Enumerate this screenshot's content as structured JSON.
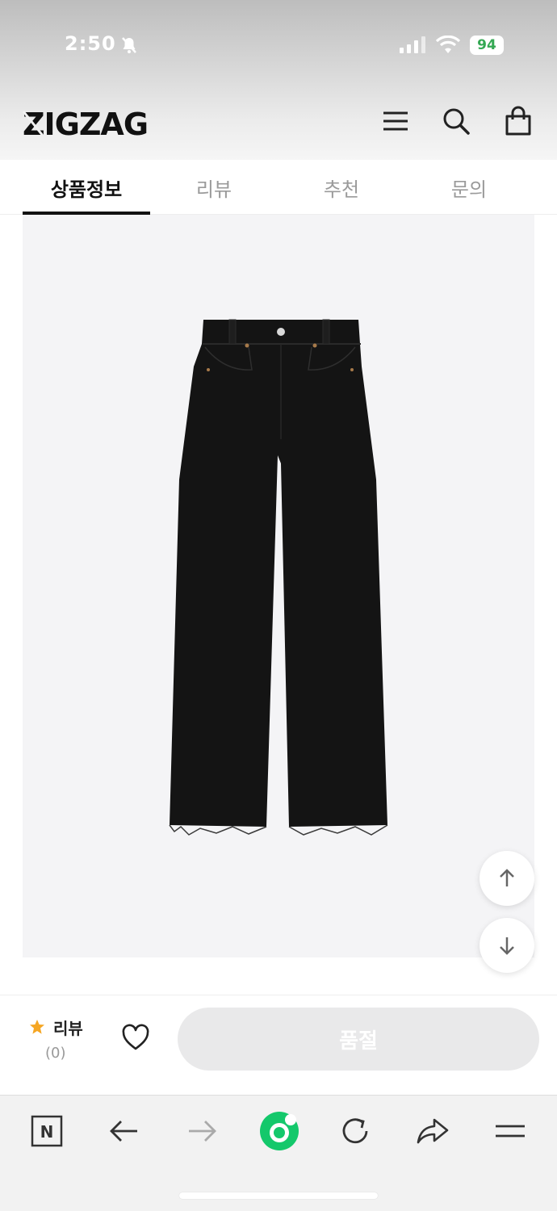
{
  "status_bar": {
    "time": "2:50",
    "battery": "94",
    "battery_color": "#34a853"
  },
  "header": {
    "logo": "ZIGZAG",
    "icons": [
      "menu-icon",
      "search-icon",
      "shopping-bag-icon"
    ]
  },
  "tabs": [
    {
      "label": "상품정보",
      "active": true
    },
    {
      "label": "리뷰",
      "active": false
    },
    {
      "label": "추천",
      "active": false
    },
    {
      "label": "문의",
      "active": false
    }
  ],
  "product": {
    "image": "black-wide-leg-jeans"
  },
  "bottom_bar": {
    "review_label": "리뷰",
    "review_count": "(0)",
    "soldout_label": "품절",
    "star_color": "#f5a623"
  },
  "browser_bar": {
    "icons": [
      "naver-icon",
      "back-arrow-icon",
      "forward-arrow-icon",
      "green-app-icon",
      "reload-icon",
      "share-icon",
      "menu-icon"
    ]
  }
}
